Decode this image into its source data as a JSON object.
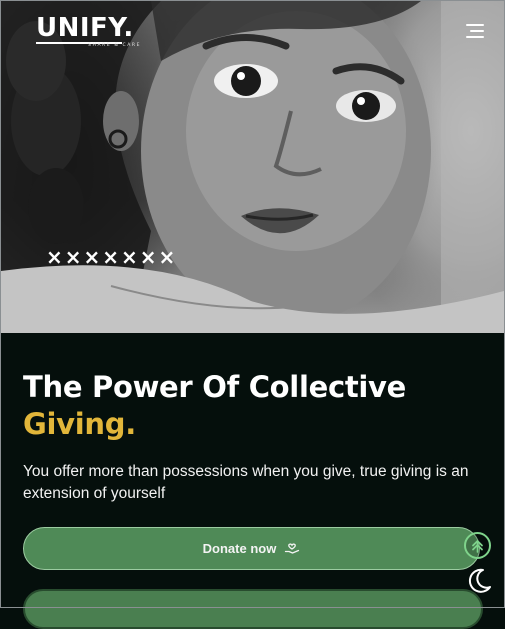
{
  "brand": {
    "name": "UNIFY.",
    "tagline": "SHARE & CARE"
  },
  "header": {
    "menu_icon": "hamburger-menu-icon"
  },
  "hero": {
    "title_line1": "The Power Of Collective",
    "title_line2": "Giving.",
    "description": "You offer more than possessions when you give, true giving is an extension of yourself",
    "donate_label": "Donate now",
    "donate_icon": "hand-heart-icon"
  },
  "overlay": {
    "xmarks": "×××××××"
  },
  "floating": {
    "scroll_top_icon": "double-chevron-up-icon",
    "theme_icon": "moon-icon"
  },
  "colors": {
    "background": "#050f0c",
    "accent": "#e2b63a",
    "button": "#4f8a57",
    "button_border": "#9ccca1",
    "scroll_top": "#7fd38b"
  }
}
